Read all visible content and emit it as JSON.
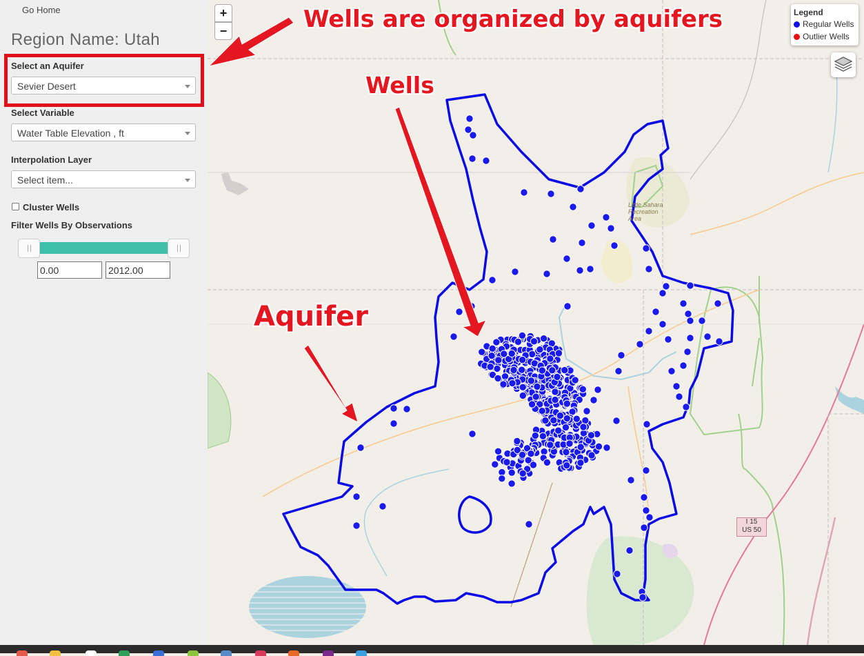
{
  "sidebar": {
    "home_link": "Go Home",
    "region_title": "Region Name: Utah",
    "aquifer_label": "Select an Aquifer",
    "aquifer_value": "Sevier Desert",
    "variable_label": "Select Variable",
    "variable_value": "Water Table Elevation , ft",
    "interp_label": "Interpolation Layer",
    "interp_value": "Select item...",
    "cluster_label": "Cluster Wells",
    "cluster_checked": false,
    "filter_label": "Filter Wells By Observations",
    "filter_min": "0.00",
    "filter_max": "2012.00"
  },
  "map": {
    "zoom_in": "+",
    "zoom_out": "−",
    "legend_title": "Legend",
    "legend_regular": "Regular Wells",
    "legend_outlier": "Outlier Wells",
    "regular_color": "#1010e8",
    "outlier_color": "#e81010",
    "aquifer_outline_color": "#0a0ae6",
    "road_shield_line1": "I 15",
    "road_shield_line2": "US 50",
    "place_label": "Little Sahara Recreation Area",
    "layers_icon": "layers-icon"
  },
  "annotations": {
    "top": "Wells are organized by aquifers",
    "wells": "Wells",
    "aquifer": "Aquifer",
    "color": "#e4161f"
  }
}
